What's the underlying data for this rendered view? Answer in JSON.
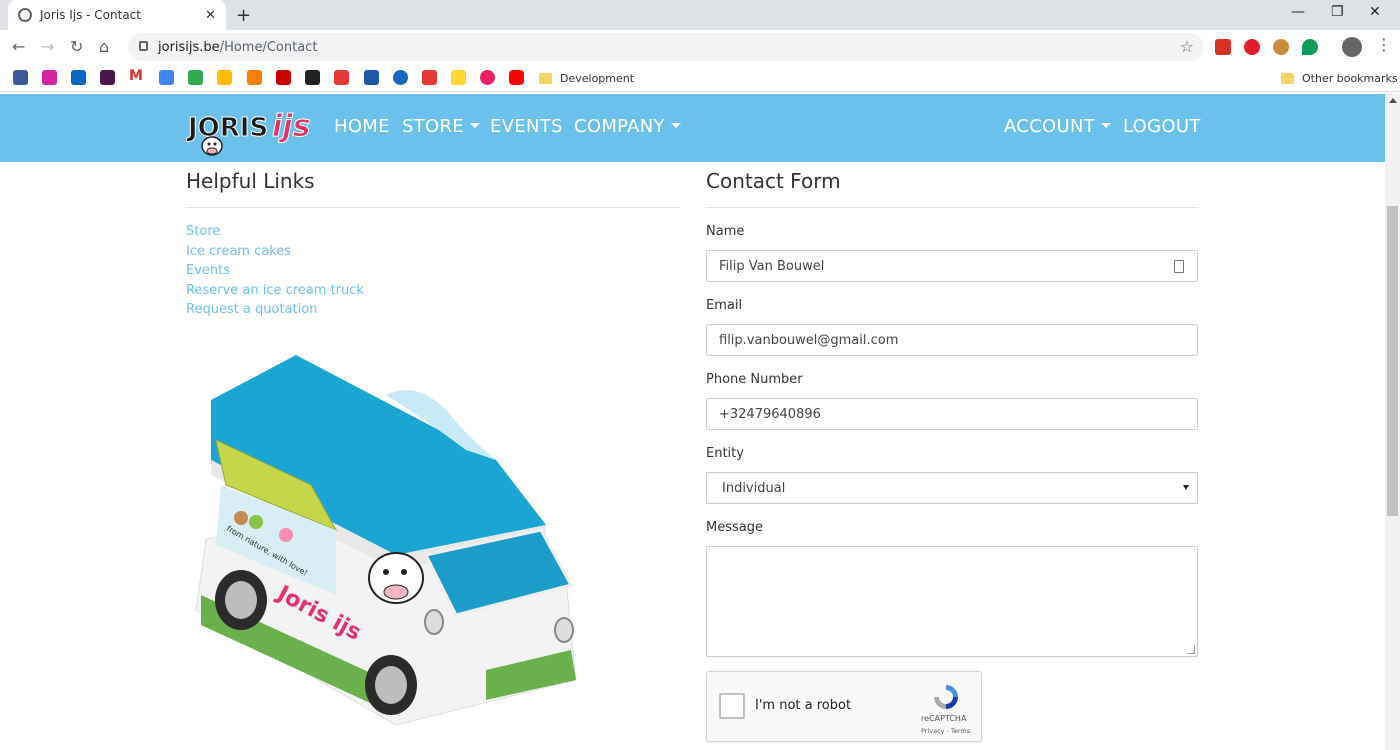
{
  "browser": {
    "tab_title": "Joris Ijs - Contact",
    "url_domain": "jorisijs.be",
    "url_path": "/Home/Contact",
    "bookmarks_folder": "Development",
    "other_bookmarks": "Other bookmarks"
  },
  "nav": {
    "logo_text": "JorisIJs",
    "home": "HOME",
    "store": "STORE",
    "events": "EVENTS",
    "company": "COMPANY",
    "account": "ACCOUNT",
    "logout": "LOGOUT",
    "accent": "#6cc0ec"
  },
  "helpful": {
    "title": "Helpful Links",
    "links": [
      "Store",
      "Ice cream cakes",
      "Events",
      "Reserve an ice cream truck",
      "Request a quotation"
    ]
  },
  "form": {
    "title": "Contact Form",
    "name_label": "Name",
    "name_value": "Filip Van Bouwel",
    "email_label": "Email",
    "email_value": "filip.vanbouwel@gmail.com",
    "phone_label": "Phone Number",
    "phone_value": "+32479640896",
    "entity_label": "Entity",
    "entity_value": "Individual",
    "message_label": "Message",
    "message_value": ""
  },
  "captcha": {
    "checkbox_text": "I'm not a robot",
    "brand": "reCAPTCHA",
    "legal": "Privacy - Terms"
  },
  "truck_texts": {
    "slogan": "from nature, with love!",
    "brand": "Joris ijs"
  }
}
